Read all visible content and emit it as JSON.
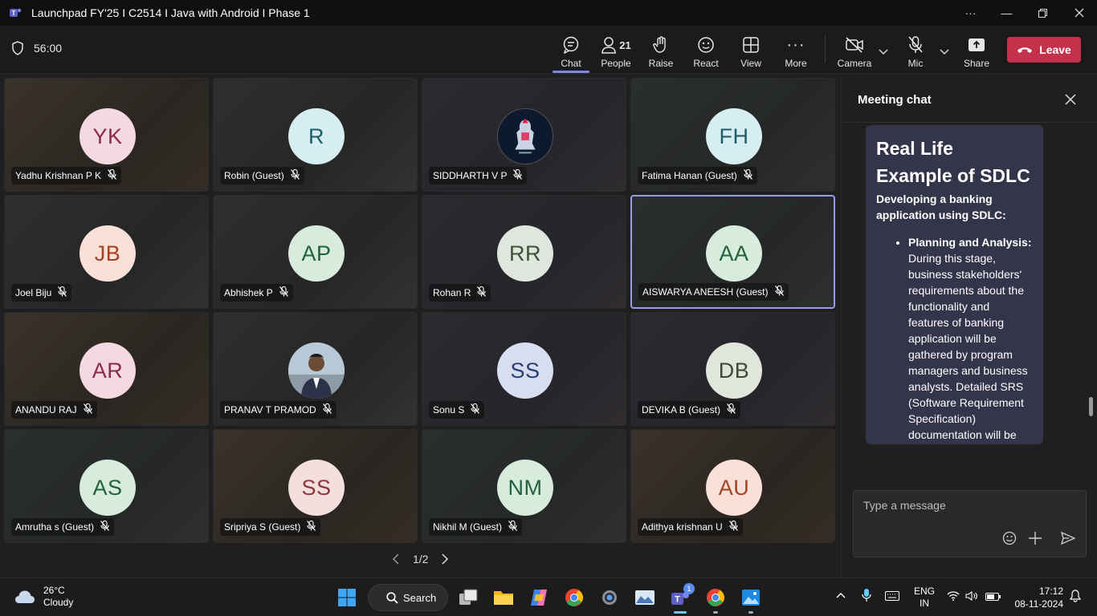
{
  "window": {
    "title": "Launchpad FY'25 I C2514 I Java with Android I Phase 1"
  },
  "toolbar": {
    "timer": "56:00",
    "chat_label": "Chat",
    "people_label": "People",
    "people_count": "21",
    "raise_label": "Raise",
    "react_label": "React",
    "view_label": "View",
    "more_label": "More",
    "camera_label": "Camera",
    "mic_label": "Mic",
    "share_label": "Share",
    "leave_label": "Leave"
  },
  "participants": [
    {
      "initials": "YK",
      "name": "Yadhu Krishnan P K",
      "bg": "#f4d8e2",
      "fg": "#8a2b4c"
    },
    {
      "initials": "R",
      "name": "Robin (Guest)",
      "bg": "#d6eef1",
      "fg": "#1f5f6b"
    },
    {
      "initials": "",
      "name": "SIDDHARTH V P",
      "bg": "#0d1a2e",
      "fg": "#fff"
    },
    {
      "initials": "FH",
      "name": "Fatima Hanan (Guest)",
      "bg": "#d6eef1",
      "fg": "#1f5f6b"
    },
    {
      "initials": "JB",
      "name": "Joel Biju",
      "bg": "#fbe0d8",
      "fg": "#a24226"
    },
    {
      "initials": "AP",
      "name": "Abhishek P",
      "bg": "#d8ecdd",
      "fg": "#22633a"
    },
    {
      "initials": "RR",
      "name": "Rohan R",
      "bg": "#dfe6dd",
      "fg": "#3d5337"
    },
    {
      "initials": "AA",
      "name": "AISWARYA ANEESH (Guest)",
      "bg": "#d8ecdd",
      "fg": "#22633a"
    },
    {
      "initials": "AR",
      "name": "ANANDU RAJ",
      "bg": "#f4d8e2",
      "fg": "#8a2b4c"
    },
    {
      "initials": "",
      "name": "PRANAV T PRAMOD",
      "bg": "#c9d6e0",
      "fg": "#fff"
    },
    {
      "initials": "SS",
      "name": "Sonu S",
      "bg": "#d6def0",
      "fg": "#2a3f75"
    },
    {
      "initials": "DB",
      "name": "DEVIKA B (Guest)",
      "bg": "#e1e6dc",
      "fg": "#3d4a33"
    },
    {
      "initials": "AS",
      "name": "Amrutha s (Guest)",
      "bg": "#d8ecdd",
      "fg": "#22633a"
    },
    {
      "initials": "SS",
      "name": "Sripriya S (Guest)",
      "bg": "#f4dede",
      "fg": "#8a3a3a"
    },
    {
      "initials": "NM",
      "name": "Nikhil M (Guest)",
      "bg": "#d8ecdd",
      "fg": "#22633a"
    },
    {
      "initials": "AU",
      "name": "Adithya krishnan U",
      "bg": "#fbe0d8",
      "fg": "#a24226"
    }
  ],
  "pager": {
    "label": "1/2"
  },
  "chat": {
    "title": "Meeting chat",
    "message_title": "Real Life Example of SDLC",
    "message_subtitle": "Developing a banking application using SDLC:",
    "bullet_heading": "Planning and Analysis:",
    "bullet_text": "During this stage, business stakeholders' requirements about the functionality and features of banking application will be gathered by program managers and business analysts. Detailed SRS (Software Requirement Specification) documentation will be produced by the",
    "compose_placeholder": "Type a message"
  },
  "taskbar": {
    "temperature": "26°C",
    "weather": "Cloudy",
    "search_label": "Search",
    "teams_badge": "1",
    "lang_top": "ENG",
    "lang_bottom": "IN",
    "time": "17:12",
    "date": "08-11-2024"
  }
}
